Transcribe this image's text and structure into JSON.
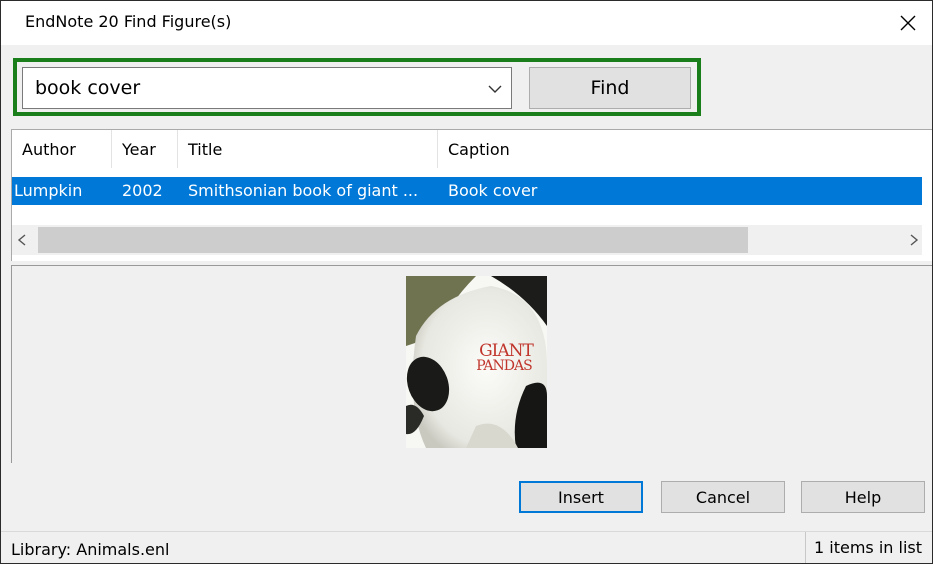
{
  "window": {
    "title": "EndNote 20 Find Figure(s)",
    "close_glyph": "✕"
  },
  "search": {
    "value": "book cover",
    "find_label": "Find"
  },
  "table": {
    "columns": [
      "Author",
      "Year",
      "Title",
      "Caption"
    ],
    "rows": [
      {
        "author": "Lumpkin",
        "year": "2002",
        "title": "Smithsonian book of giant ...",
        "caption": "Book cover",
        "selected": true
      }
    ]
  },
  "preview": {
    "image_text_line1": "GIANT",
    "image_text_line2": "PANDAS"
  },
  "buttons": {
    "insert": "Insert",
    "cancel": "Cancel",
    "help": "Help"
  },
  "status": {
    "library": "Library: Animals.enl",
    "count": "1 items in list"
  },
  "colors": {
    "highlight_border": "#1a7f1a",
    "selection": "#0078d7"
  }
}
